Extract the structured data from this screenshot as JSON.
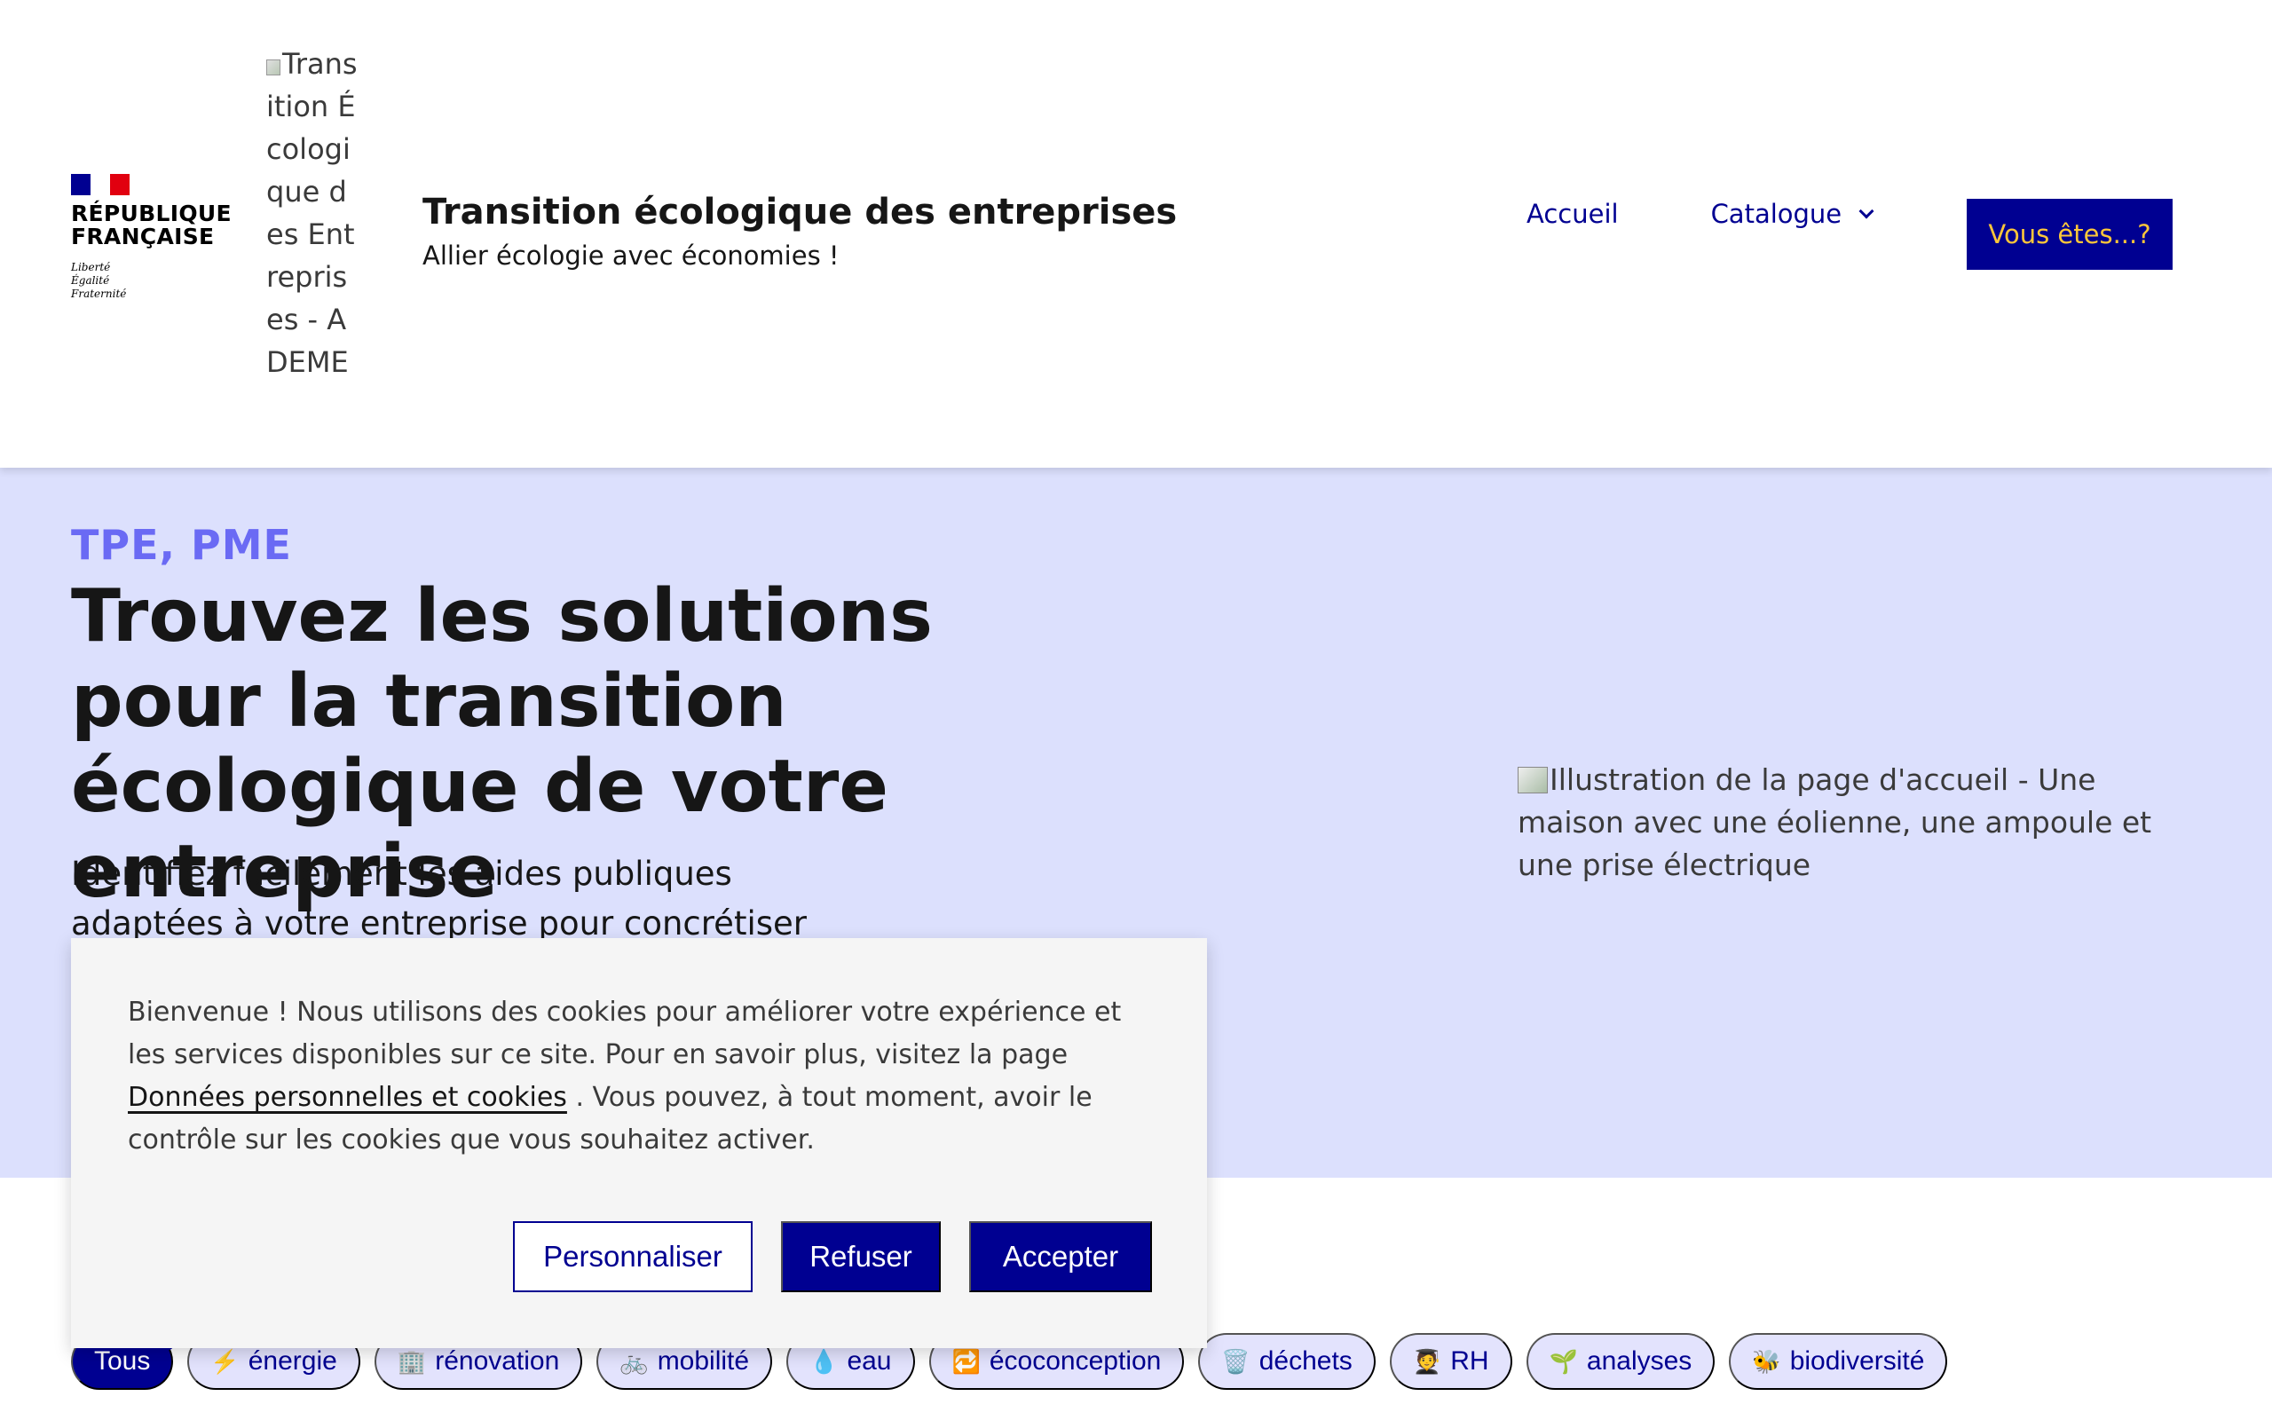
{
  "header": {
    "marianne": {
      "republique_line1": "RÉPUBLIQUE",
      "republique_line2": "FRANÇAISE",
      "devise_1": "Liberté",
      "devise_2": "Égalité",
      "devise_3": "Fraternité",
      "flag_colors": [
        "#000091",
        "#ffffff",
        "#e1000f"
      ]
    },
    "operator_logo_alt": "Transition Écologique des Entreprises - ADEME",
    "service_title": "Transition écologique des entreprises",
    "service_tagline": "Allier écologie avec économies !",
    "nav": {
      "home": "Accueil",
      "catalogue": "Catalogue",
      "cta": "Vous êtes...?"
    }
  },
  "hero": {
    "eyebrow": "TPE, PME",
    "title": "Trouvez les solutions pour la transition écologique de votre entreprise",
    "lead": "Identifiez facilement les aides publiques adaptées à votre entreprise pour concrétiser vos projets",
    "illustration_alt": "Illustration de la page d'accueil - Une maison avec une éolienne, une ampoule et une prise électrique"
  },
  "tags": [
    {
      "emoji": "",
      "label": "Tous",
      "active": true
    },
    {
      "emoji": "⚡",
      "label": "énergie"
    },
    {
      "emoji": "🏢",
      "label": "rénovation"
    },
    {
      "emoji": "🚲",
      "label": "mobilité"
    },
    {
      "emoji": "💧",
      "label": "eau"
    },
    {
      "emoji": "🔁",
      "label": "écoconception"
    },
    {
      "emoji": "🗑️",
      "label": "déchets"
    },
    {
      "emoji": "🧑‍🎓",
      "label": "RH"
    },
    {
      "emoji": "🌱",
      "label": "analyses"
    },
    {
      "emoji": "🐝",
      "label": "biodiversité"
    }
  ],
  "cookie_banner": {
    "text_before": "Bienvenue ! Nous utilisons des cookies pour améliorer votre expérience et les services disponibles sur ce site. Pour en savoir plus, visitez la page ",
    "link": "Données personnelles et cookies",
    "text_after": " . Vous pouvez, à tout moment, avoir le contrôle sur les cookies que vous souhaitez activer.",
    "customize": "Personnaliser",
    "refuse": "Refuser",
    "accept": "Accepter"
  }
}
